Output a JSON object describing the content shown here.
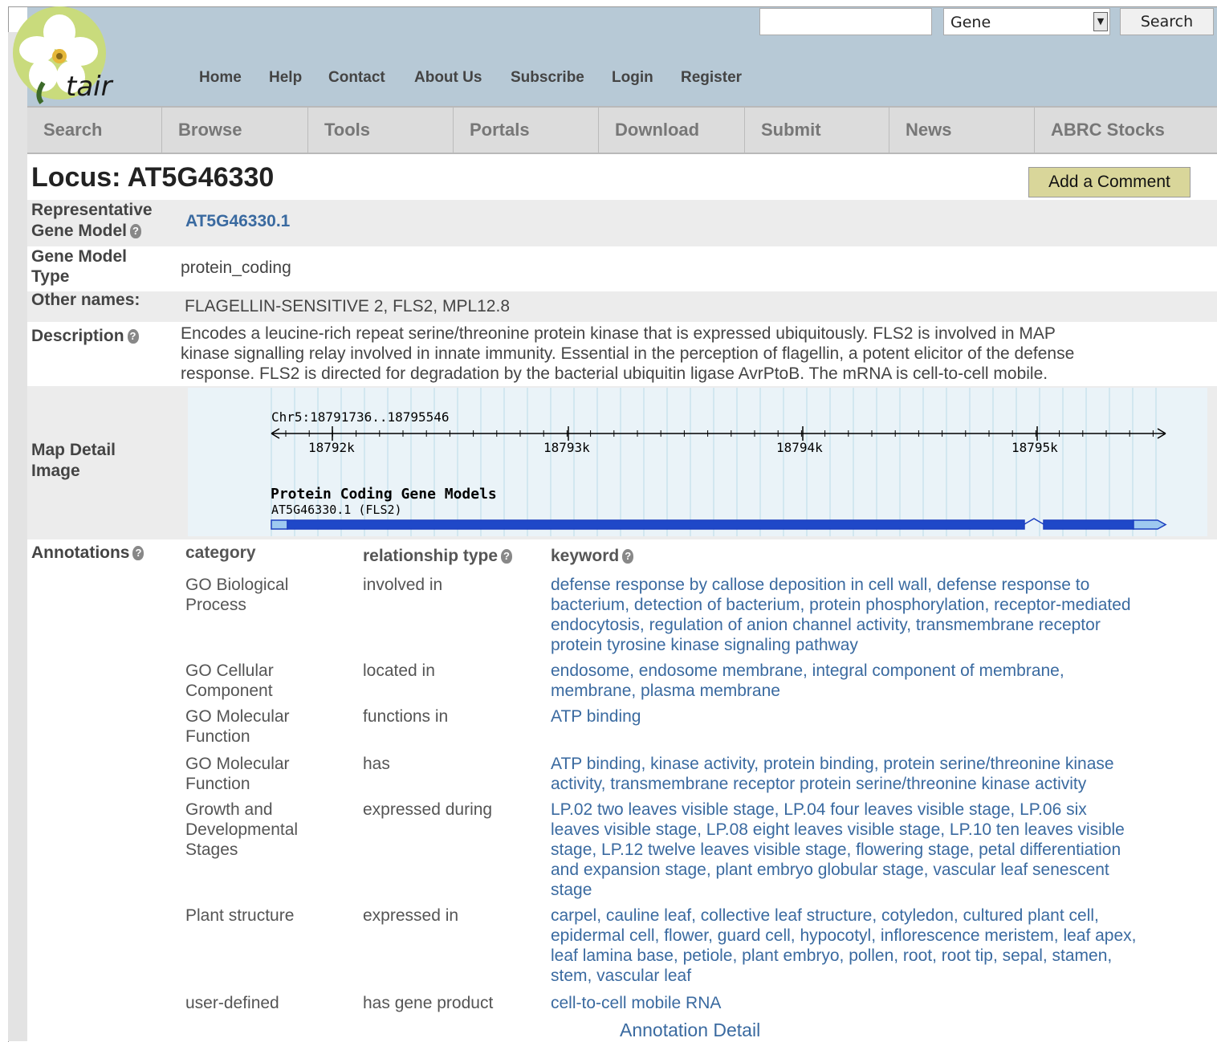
{
  "header": {
    "logo_text": "tair",
    "search": {
      "placeholder": "",
      "select_value": "Gene",
      "button": "Search"
    },
    "links": [
      "Home",
      "Help",
      "Contact",
      "About Us",
      "Subscribe",
      "Login",
      "Register"
    ]
  },
  "nav": [
    "Search",
    "Browse",
    "Tools",
    "Portals",
    "Download",
    "Submit",
    "News",
    "ABRC Stocks"
  ],
  "page": {
    "title": "Locus: AT5G46330",
    "add_comment": "Add a Comment"
  },
  "fields": {
    "rep_label_1": "Representative",
    "rep_label_2": "Gene Model",
    "rep_value": "AT5G46330.1",
    "type_label_1": "Gene Model",
    "type_label_2": "Type",
    "type_value": "protein_coding",
    "other_label": "Other names:",
    "other_value": "FLAGELLIN-SENSITIVE 2, FLS2, MPL12.8",
    "desc_label": "Description",
    "desc_lines": [
      "Encodes a leucine-rich repeat serine/threonine protein kinase that is expressed ubiquitously. FLS2 is involved in MAP",
      "kinase signalling relay involved in innate immunity. Essential in the perception of flagellin, a potent elicitor of the defense",
      "response. FLS2 is directed for degradation by the bacterial ubiquitin ligase AvrPtoB. The mRNA is cell-to-cell mobile."
    ],
    "map_label_1": "Map Detail",
    "map_label_2": "Image"
  },
  "map": {
    "region": "Chr5:18791736..18795546",
    "ticks": [
      "18792k",
      "18793k",
      "18794k",
      "18795k"
    ],
    "track_title": "Protein Coding Gene Models",
    "gene_label": "AT5G46330.1 (FLS2)"
  },
  "annotations": {
    "label": "Annotations",
    "headers": {
      "category": "category",
      "relationship": "relationship type",
      "keyword": "keyword"
    },
    "rows": [
      {
        "category": [
          "GO Biological",
          "Process"
        ],
        "relationship": "involved in",
        "keyword": [
          "defense response by callose deposition in cell wall, defense response to",
          "bacterium, detection of bacterium, protein phosphorylation, receptor-mediated",
          "endocytosis, regulation of anion channel activity, transmembrane receptor",
          "protein tyrosine kinase signaling pathway"
        ]
      },
      {
        "category": [
          "GO Cellular",
          "Component"
        ],
        "relationship": "located in",
        "keyword": [
          "endosome, endosome membrane, integral component of membrane,",
          "membrane, plasma membrane"
        ]
      },
      {
        "category": [
          "GO Molecular",
          "Function"
        ],
        "relationship": "functions in",
        "keyword": [
          "ATP binding"
        ]
      },
      {
        "category": [
          "GO Molecular",
          "Function"
        ],
        "relationship": "has",
        "keyword": [
          "ATP binding, kinase activity, protein binding, protein serine/threonine kinase",
          "activity, transmembrane receptor protein serine/threonine kinase activity"
        ]
      },
      {
        "category": [
          "Growth and",
          "Developmental",
          "Stages"
        ],
        "relationship": "expressed during",
        "keyword": [
          "LP.02 two leaves visible stage, LP.04 four leaves visible stage, LP.06 six",
          "leaves visible stage, LP.08 eight leaves visible stage, LP.10 ten leaves visible",
          "stage, LP.12 twelve leaves visible stage, flowering stage, petal differentiation",
          "and expansion stage, plant embryo globular stage, vascular leaf senescent",
          "stage"
        ]
      },
      {
        "category": [
          "Plant structure"
        ],
        "relationship": "expressed in",
        "keyword": [
          "carpel, cauline leaf, collective leaf structure, cotyledon, cultured plant cell,",
          "epidermal cell, flower, guard cell, hypocotyl, inflorescence meristem, leaf apex,",
          "leaf lamina base, petiole, plant embryo, pollen, root, root tip, sepal, stamen,",
          "stem, vascular leaf"
        ]
      },
      {
        "category": [
          "user-defined"
        ],
        "relationship": "has gene product",
        "keyword": [
          "cell-to-cell mobile RNA"
        ]
      }
    ],
    "detail_link": "Annotation Detail"
  }
}
